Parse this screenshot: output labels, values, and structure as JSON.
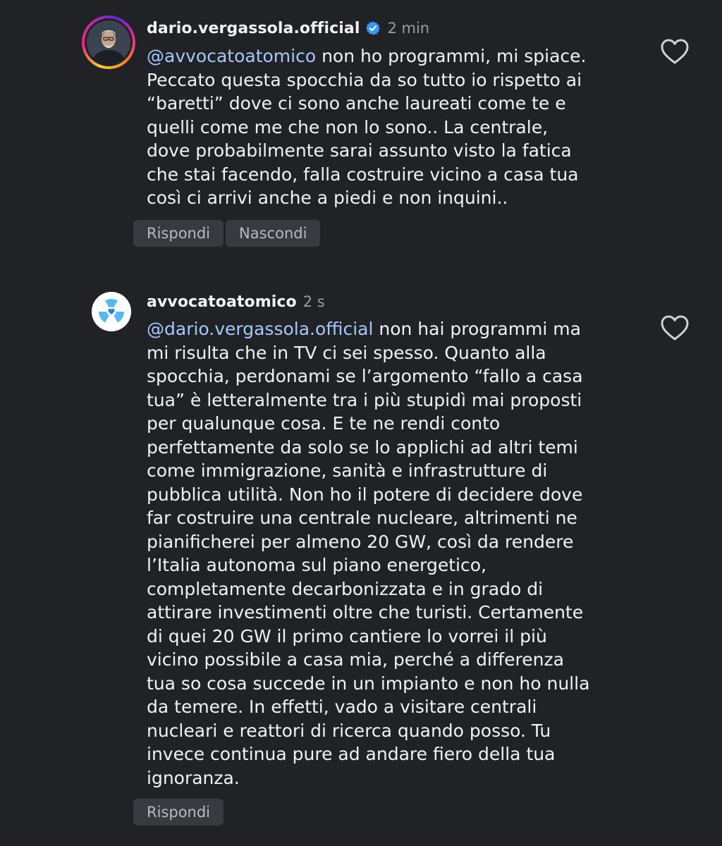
{
  "comments": [
    {
      "username": "dario.vergassola.official",
      "verified": true,
      "time": "2 min",
      "mention": "@avvocatoatomico",
      "lines": [
        " non ho programmi, mi spiace.",
        "Peccato questa spocchia da so tutto io rispetto ai",
        "“baretti” dove ci sono anche laureati come te e",
        "quelli come me che non lo sono.. La centrale,",
        "dove probabilmente sarai assunto visto la fatica",
        "che stai facendo, falla costruire vicino a casa tua",
        "così ci arrivi anche a piedi e non inquini.."
      ],
      "actions": [
        "Rispondi",
        "Nascondi"
      ],
      "avatar_icon": "profile-photo"
    },
    {
      "username": "avvocatoatomico",
      "verified": false,
      "time": "2 s",
      "mention": "@dario.vergassola.official",
      "lines": [
        " non hai programmi ma",
        "mi risulta che in TV ci sei spesso. Quanto alla",
        "spocchia, perdonami se l’argomento “fallo a casa",
        "tua” è letteralmente tra i più stupidì mai proposti",
        "per qualunque cosa. E te ne rendi conto",
        "perfettamente da solo se lo applichi ad altri temi",
        "come immigrazione, sanità e infrastrutture di",
        "pubblica utilità. Non ho il potere di decidere dove",
        "far costruire una centrale nucleare, altrimenti ne",
        "pianificherei per almeno 20 GW, così da rendere",
        "l’Italia autonoma sul piano energetico,",
        "completamente decarbonizzata e in grado di",
        "attirare investimenti oltre che turisti. Certamente",
        "di quei 20 GW il primo cantiere lo vorrei il più",
        "vicino possibile a casa mia, perché a differenza",
        "tua so cosa succede in un impianto e non ho nulla",
        "da temere. In effetti, vado a visitare centrali",
        "nucleari e reattori di ricerca quando posso. Tu",
        "invece continua pure ad andare fiero della tua",
        "ignoranza."
      ],
      "actions": [
        "Rispondi"
      ],
      "avatar_icon": "radiation-heart-icon"
    }
  ],
  "colors": {
    "background": "#202226",
    "mention": "#a8c7fa",
    "verified": "#3897f0",
    "radiation": "#5ab8ef",
    "pill": "#383a3f"
  },
  "icons": {
    "verified": "verified-badge-icon",
    "like": "heart-outline-icon"
  }
}
